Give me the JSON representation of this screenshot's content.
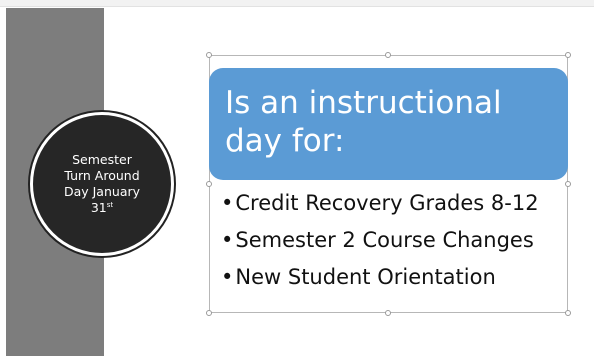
{
  "sidebar_badge": {
    "line1": "Semester",
    "line2": "Turn Around",
    "line3": "Day January",
    "line4": "31",
    "superscript": "st"
  },
  "content": {
    "title": "Is an instructional day for:",
    "bullet_symbol": "•",
    "bullets": [
      "Credit Recovery Grades 8-12",
      "Semester 2 Course Changes",
      "New Student Orientation"
    ]
  },
  "colors": {
    "title_fill": "#5b9bd5",
    "sidebar": "#7d7d7d",
    "badge": "#262626"
  }
}
